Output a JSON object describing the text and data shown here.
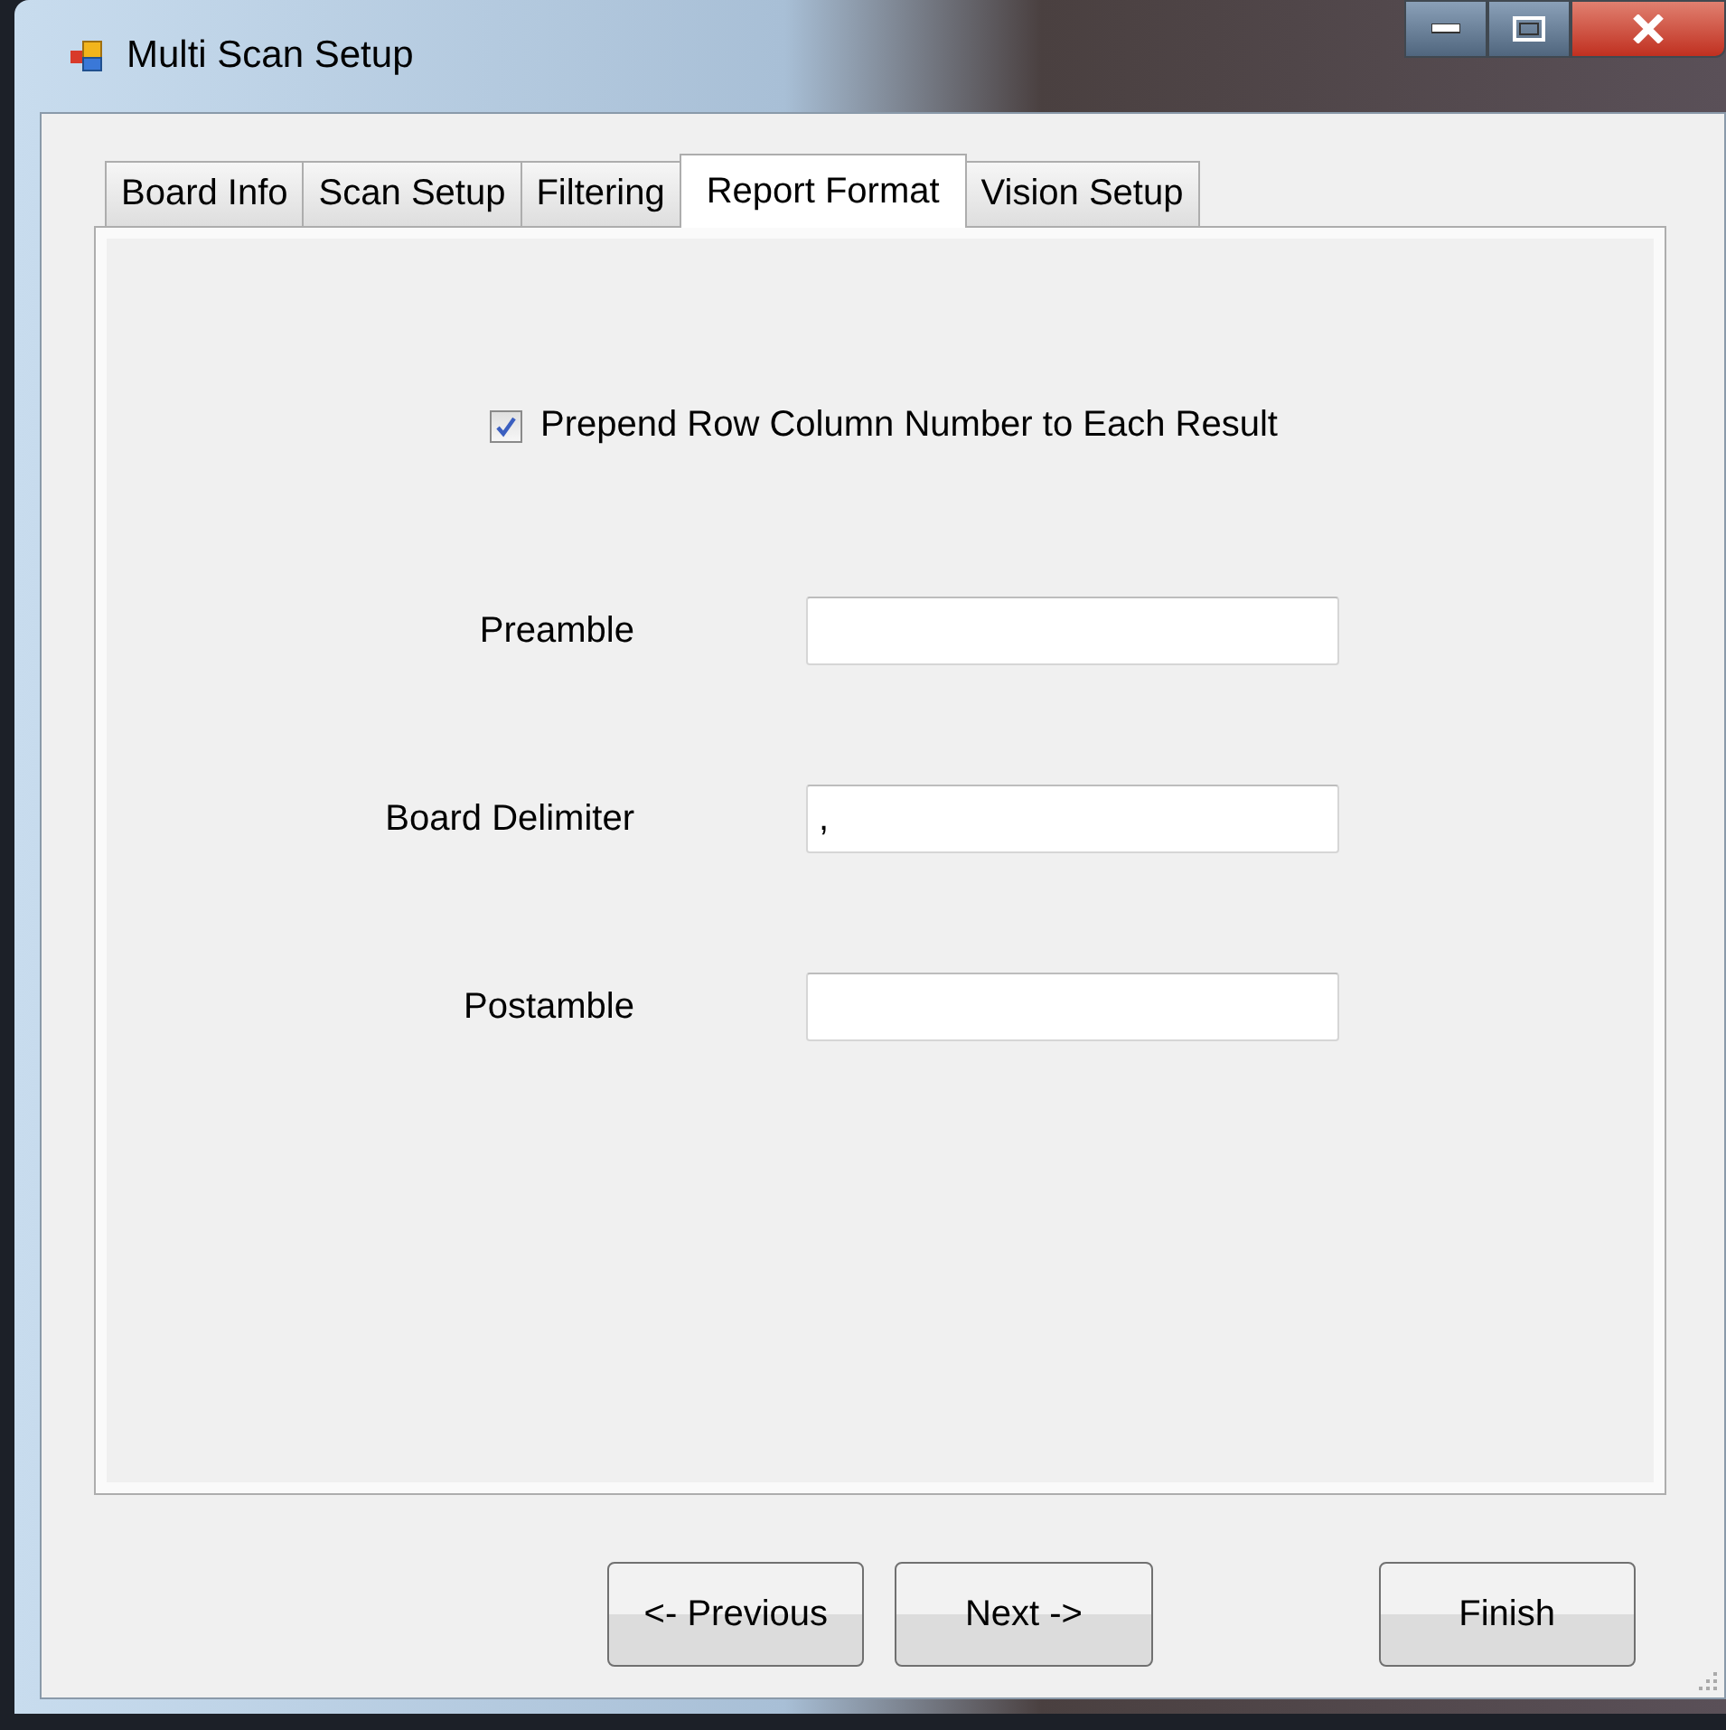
{
  "window": {
    "title": "Multi Scan Setup"
  },
  "tabs": [
    {
      "label": "Board Info",
      "selected": false
    },
    {
      "label": "Scan Setup",
      "selected": false
    },
    {
      "label": "Filtering",
      "selected": false
    },
    {
      "label": "Report Format",
      "selected": true
    },
    {
      "label": "Vision Setup",
      "selected": false
    }
  ],
  "checkbox": {
    "label": "Prepend Row Column Number to Each Result",
    "checked": true
  },
  "fields": [
    {
      "label": "Preamble"
    },
    {
      "label": "Board Delimiter",
      "value": ","
    },
    {
      "label": "Postamble"
    }
  ],
  "buttons": [
    {
      "label": "<- Previous"
    },
    {
      "label": "Next ->"
    },
    {
      "label": "Finish"
    }
  ]
}
